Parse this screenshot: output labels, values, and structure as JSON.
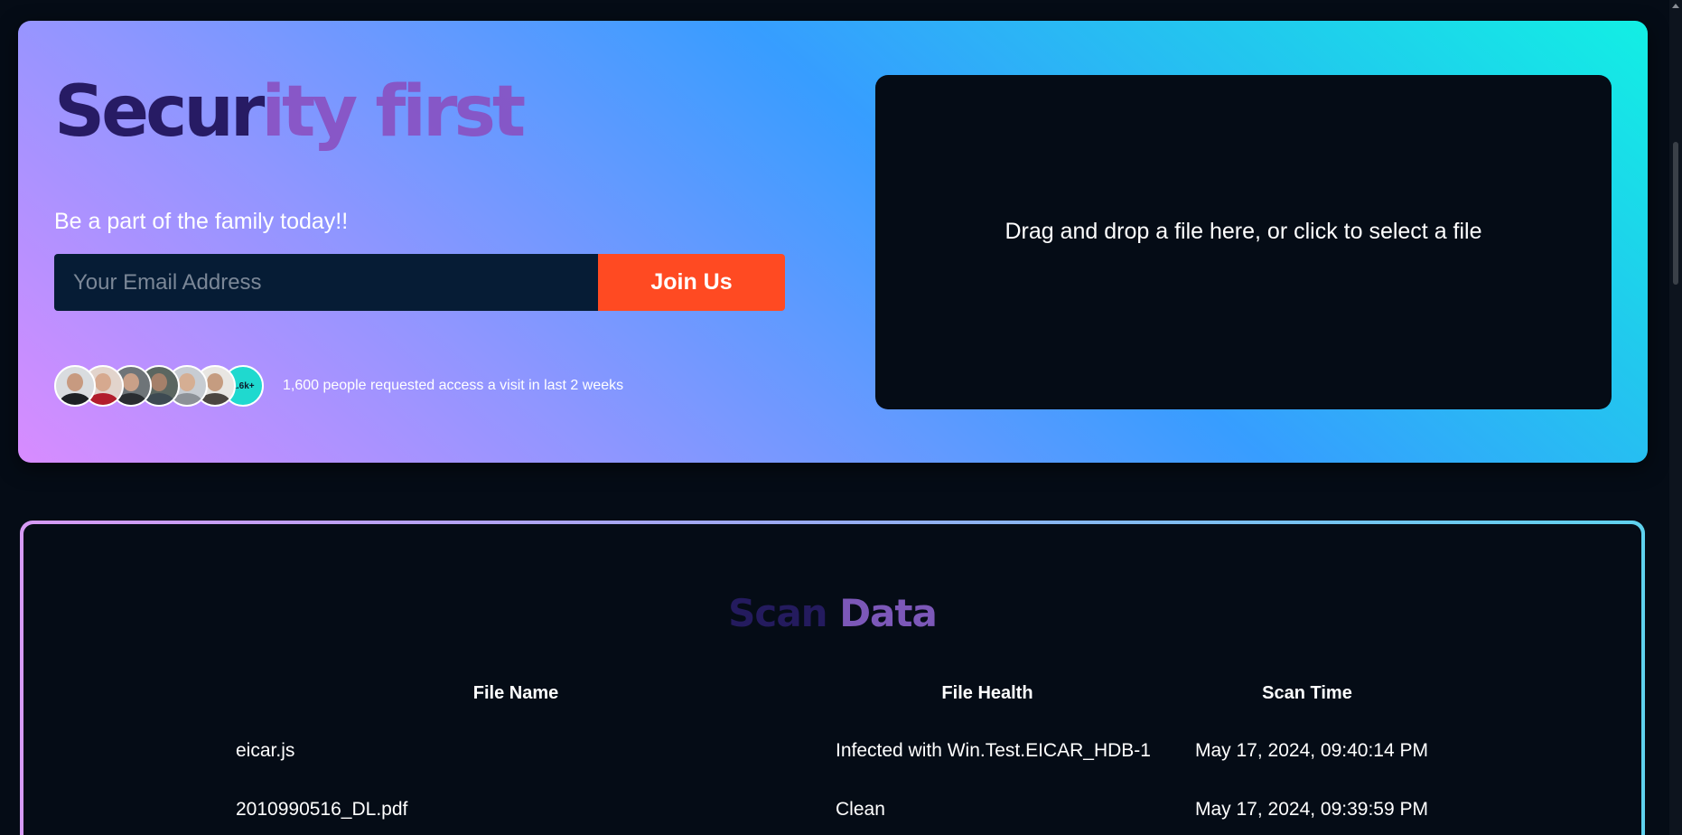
{
  "hero": {
    "title_part1": "Secur",
    "title_part2": "ity first",
    "subtitle": "Be a part of the family today!!",
    "email_placeholder": "Your Email Address",
    "join_label": "Join Us",
    "avatar_count_label": "1.6k+",
    "social_proof_text": "1,600 people requested access a visit in last 2 weeks"
  },
  "dropzone": {
    "text": "Drag and drop a file here, or click to select a file"
  },
  "scan": {
    "title_part1": "Scan",
    "title_part2": "Data",
    "columns": [
      "File Name",
      "File Health",
      "Scan Time"
    ],
    "rows": [
      {
        "file_name": "eicar.js",
        "file_health": "Infected with Win.Test.EICAR_HDB-1",
        "scan_time": "May 17, 2024, 09:40:14 PM"
      },
      {
        "file_name": "2010990516_DL.pdf",
        "file_health": "Clean",
        "scan_time": "May 17, 2024, 09:39:59 PM"
      }
    ]
  },
  "colors": {
    "background": "#050c16",
    "accent_button": "#ff4a22",
    "input_background": "#061c35",
    "title_dark": "#271b64",
    "title_purple": "#8a4fc0"
  }
}
